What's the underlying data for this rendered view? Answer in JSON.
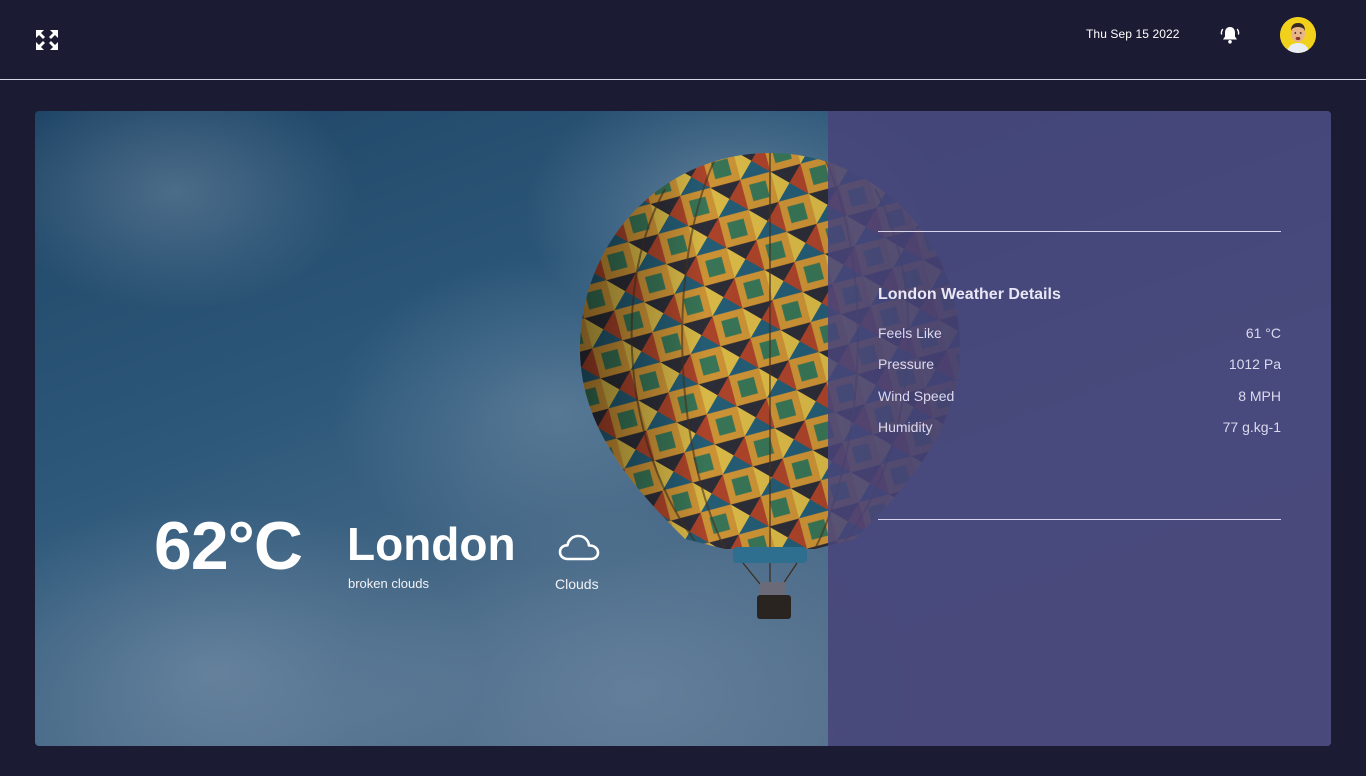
{
  "header": {
    "fullscreen_icon": "expand-arrows-icon",
    "date": "Thu Sep 15 2022",
    "bell_icon": "bell-icon",
    "avatar_icon": "user-avatar"
  },
  "weather": {
    "temperature": "62°C",
    "city": "London",
    "description": "broken clouds",
    "condition_icon": "cloud-icon",
    "condition": "Clouds"
  },
  "details": {
    "title": "London Weather Details",
    "rows": [
      {
        "label": "Feels Like",
        "value": "61 °C"
      },
      {
        "label": "Pressure",
        "value": "1012 Pa"
      },
      {
        "label": "Wind Speed",
        "value": "8 MPH"
      },
      {
        "label": "Humidity",
        "value": "77 g.kg-1"
      }
    ]
  },
  "colors": {
    "background": "#1b1b33",
    "panel": "#48447a",
    "text": "#ffffff",
    "avatar_bg": "#f2d11c"
  }
}
